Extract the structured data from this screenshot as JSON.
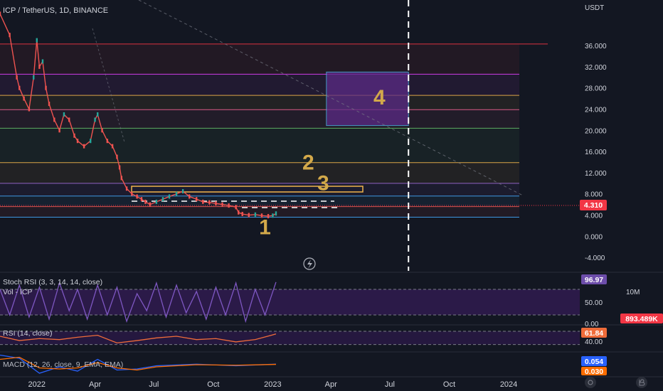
{
  "header": {
    "symbol_line": "ICP / TetherUS, 1D, BINANCE",
    "currency": "USDT"
  },
  "annotations": {
    "labels": [
      "1",
      "2",
      "3",
      "4"
    ],
    "color": "#d3a94a"
  },
  "colors": {
    "background": "#131722",
    "candle_up": "#26a69a",
    "candle_down": "#ef5350",
    "price_badge": "#f23645",
    "stoch_k": "#7e57c2",
    "rsi_line": "#ef6c3a",
    "macd_line": "#2962ff",
    "signal_line": "#ff6d00",
    "zone_purple": "#5b2a86"
  },
  "chart_data": [
    {
      "type": "line",
      "title": "ICP / TetherUS, 1D, BINANCE",
      "axis": "USDT",
      "y_ticks": [
        "36.000",
        "32.000",
        "28.000",
        "24.000",
        "20.000",
        "16.000",
        "12.000",
        "8.000",
        "4.000",
        "0.000",
        "-4.000"
      ],
      "y_tick_values": [
        36,
        32,
        28,
        24,
        20,
        16,
        12,
        8,
        4,
        0,
        -4
      ],
      "ylim": [
        -6.8,
        44.6
      ],
      "x_ticks": [
        "2022",
        "Apr",
        "Jul",
        "Oct",
        "2023",
        "Apr",
        "Jul",
        "Oct",
        "2024"
      ],
      "x_tick_dates": [
        "2022-01-01",
        "2022-04-01",
        "2022-07-01",
        "2022-10-01",
        "2023-01-01",
        "2023-04-01",
        "2023-07-01",
        "2023-10-01",
        "2024-01-01"
      ],
      "xlim": [
        "2021-11-05",
        "2024-04-20"
      ],
      "last_price": "4.310",
      "series": [
        {
          "x": [
            "2021-11-05",
            "2021-11-20",
            "2021-12-01",
            "2021-12-05",
            "2021-12-12",
            "2021-12-20",
            "2021-12-27",
            "2022-01-01",
            "2022-01-05",
            "2022-01-10",
            "2022-01-15",
            "2022-01-20",
            "2022-01-28",
            "2022-02-05",
            "2022-02-12",
            "2022-02-20",
            "2022-02-28",
            "2022-03-05",
            "2022-03-15",
            "2022-03-25",
            "2022-04-01",
            "2022-04-05",
            "2022-04-12",
            "2022-04-20",
            "2022-04-28",
            "2022-05-05",
            "2022-05-09",
            "2022-05-12",
            "2022-05-20",
            "2022-05-28",
            "2022-06-05",
            "2022-06-12",
            "2022-06-18",
            "2022-06-25",
            "2022-07-05",
            "2022-07-15",
            "2022-07-25",
            "2022-08-05",
            "2022-08-15",
            "2022-08-25",
            "2022-09-05",
            "2022-09-15",
            "2022-09-25",
            "2022-10-05",
            "2022-10-15",
            "2022-10-25",
            "2022-11-05",
            "2022-11-09",
            "2022-11-15",
            "2022-11-25",
            "2022-12-05",
            "2022-12-15",
            "2022-12-25",
            "2023-01-01",
            "2023-01-06"
          ],
          "y": [
            42,
            38,
            30,
            28,
            26,
            24,
            30,
            37,
            32,
            33,
            28,
            25,
            22,
            20,
            23,
            22,
            19,
            18,
            17,
            18,
            22,
            23,
            20,
            18,
            17,
            15,
            13,
            11,
            9,
            8,
            7.5,
            7,
            6.5,
            6,
            6.5,
            7,
            7.5,
            8,
            8.5,
            7.5,
            7,
            6.5,
            6.4,
            6.2,
            6,
            5.8,
            5.5,
            4.5,
            4.2,
            4,
            4.1,
            3.9,
            3.8,
            3.9,
            4.3
          ]
        }
      ],
      "horizontal_levels": [
        {
          "value": 36.3,
          "color": "#f23645"
        },
        {
          "value": 30.6,
          "color": "#e040fb"
        },
        {
          "value": 26.6,
          "color": "#f0b44c"
        },
        {
          "value": 23.9,
          "color": "#f06292"
        },
        {
          "value": 20.4,
          "color": "#66bb6a"
        },
        {
          "value": 13.9,
          "color": "#f0b44c"
        },
        {
          "value": 10.0,
          "color": "#9c6ad6"
        },
        {
          "value": 7.6,
          "color": "#42a5f5"
        },
        {
          "value": 5.6,
          "color": "#ef5350"
        },
        {
          "value": 3.6,
          "color": "#42a5f5"
        }
      ],
      "annotations": [
        {
          "text": "1",
          "date": "2022-12-20",
          "value": 0.4
        },
        {
          "text": "2",
          "date": "2023-02-25",
          "value": 12.6
        },
        {
          "text": "3",
          "date": "2023-03-20",
          "value": 8.7
        },
        {
          "text": "4",
          "date": "2023-06-15",
          "value": 24.9
        }
      ],
      "zones": [
        {
          "from": "2023-03-25",
          "to": "2023-07-30",
          "top": 31.0,
          "bottom": 20.9,
          "label": "4"
        }
      ],
      "vertical_marker_date": "2023-07-30"
    },
    {
      "type": "line",
      "title": "Stoch RSI (3, 3, 14, 14, close)",
      "overlay_label": "Vol - ICP",
      "y_ticks": [
        "50.00",
        "0.00"
      ],
      "y_tick_values": [
        50,
        0
      ],
      "ylim": [
        0,
        115
      ],
      "value_badges": [
        "96.97",
        "893.489K"
      ],
      "volume_scale_label": "10M",
      "band": [
        20,
        80
      ],
      "series": [
        {
          "name": "%K",
          "x": [
            "2021-11-05",
            "2021-11-20",
            "2021-12-05",
            "2021-12-20",
            "2022-01-05",
            "2022-01-20",
            "2022-02-05",
            "2022-02-20",
            "2022-03-05",
            "2022-03-20",
            "2022-04-05",
            "2022-04-20",
            "2022-05-05",
            "2022-05-20",
            "2022-06-05",
            "2022-06-20",
            "2022-07-05",
            "2022-07-20",
            "2022-08-05",
            "2022-08-20",
            "2022-09-05",
            "2022-09-20",
            "2022-10-05",
            "2022-10-20",
            "2022-11-05",
            "2022-11-20",
            "2022-12-05",
            "2022-12-20",
            "2023-01-06"
          ],
          "y": [
            80,
            20,
            90,
            15,
            85,
            10,
            95,
            30,
            80,
            10,
            90,
            20,
            85,
            5,
            70,
            30,
            95,
            15,
            90,
            25,
            75,
            10,
            85,
            20,
            95,
            5,
            80,
            20,
            96.97
          ]
        }
      ]
    },
    {
      "type": "line",
      "title": "RSI (14, close)",
      "y_ticks": [
        "40.00"
      ],
      "y_tick_values": [
        40
      ],
      "ylim": [
        10,
        85
      ],
      "value_badges": [
        "61.84"
      ],
      "band": [
        30,
        70
      ],
      "series": [
        {
          "name": "RSI",
          "x": [
            "2021-11-05",
            "2021-12-05",
            "2022-01-05",
            "2022-02-05",
            "2022-03-05",
            "2022-04-05",
            "2022-05-05",
            "2022-06-05",
            "2022-07-05",
            "2022-08-05",
            "2022-09-05",
            "2022-10-05",
            "2022-11-05",
            "2022-12-05",
            "2023-01-06"
          ],
          "y": [
            55,
            42,
            48,
            45,
            52,
            58,
            35,
            42,
            50,
            55,
            45,
            48,
            38,
            45,
            61.84
          ]
        }
      ]
    },
    {
      "type": "line",
      "title": "MACD (12, 26, close, 9, EMA, EMA)",
      "value_badges": [
        "0.054",
        "0.030"
      ],
      "ylim": [
        -1,
        1
      ],
      "series": [
        {
          "name": "MACD",
          "x": [
            "2021-11-05",
            "2021-12-05",
            "2022-01-05",
            "2022-02-05",
            "2022-03-05",
            "2022-04-05",
            "2022-05-05",
            "2022-06-05",
            "2022-07-05",
            "2022-09-05",
            "2022-11-05",
            "2023-01-06"
          ],
          "y": [
            0.9,
            0.6,
            -0.8,
            -0.2,
            -0.6,
            0.5,
            -0.5,
            -0.4,
            -0.1,
            0.05,
            -0.1,
            0.054
          ]
        },
        {
          "name": "Signal",
          "x": [
            "2021-11-05",
            "2021-12-05",
            "2022-01-05",
            "2022-02-05",
            "2022-03-05",
            "2022-04-05",
            "2022-05-05",
            "2022-06-05",
            "2022-07-05",
            "2022-09-05",
            "2022-11-05",
            "2023-01-06"
          ],
          "y": [
            0.5,
            0.7,
            -0.3,
            -0.4,
            -0.3,
            0.2,
            -0.3,
            -0.5,
            -0.2,
            0.0,
            -0.05,
            0.03
          ]
        }
      ]
    }
  ]
}
